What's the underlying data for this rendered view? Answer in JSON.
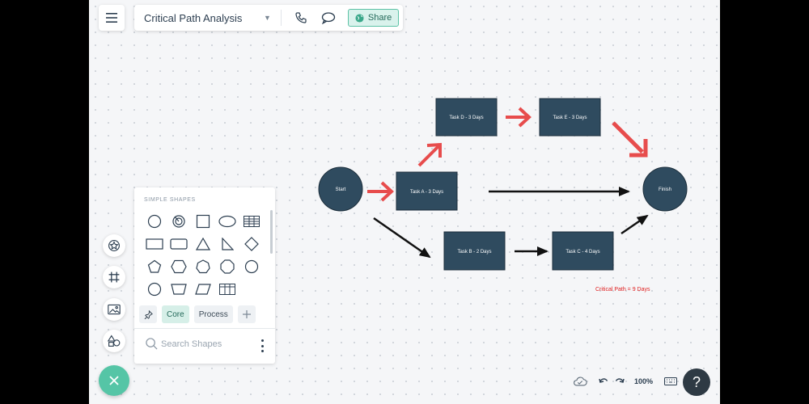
{
  "header": {
    "menu_icon": "hamburger-icon",
    "title": "Critical Path Analysis",
    "share_label": "Share"
  },
  "shapes_panel": {
    "heading": "SIMPLE SHAPES",
    "tabs": {
      "core": "Core",
      "process": "Process"
    },
    "search_placeholder": "Search Shapes"
  },
  "diagram": {
    "nodes": {
      "start": "Start",
      "finish": "Finish",
      "task_a": "Task A - 3 Days",
      "task_b": "Task B - 2 Days",
      "task_c": "Task C - 4 Days",
      "task_d": "Task D - 3 Days",
      "task_e": "Task E - 3 Days"
    },
    "critical_path_note": "Critical Path = 9 Days",
    "colors": {
      "node": "#2f4b5f",
      "critical_arrow": "#e74c4c",
      "normal_arrow": "#111111"
    }
  },
  "footer": {
    "zoom": "100%",
    "help": "?"
  },
  "colors": {
    "accent": "#55c5a6",
    "share_bg": "#d9f2ec"
  }
}
